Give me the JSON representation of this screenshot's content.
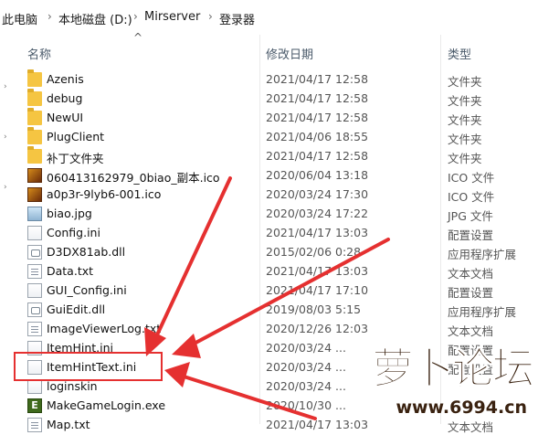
{
  "breadcrumb": [
    "此电脑",
    "本地磁盘 (D:)",
    "Mirserver",
    "登录器"
  ],
  "breadcrumb_sep": "›",
  "columns": {
    "name": "名称",
    "date": "修改日期",
    "type": "类型"
  },
  "files": [
    {
      "name": "Azenis",
      "date": "2021/04/17 12:58",
      "type": "文件夹",
      "icon": "folder-icon"
    },
    {
      "name": "debug",
      "date": "2021/04/17 12:58",
      "type": "文件夹",
      "icon": "folder-icon"
    },
    {
      "name": "NewUI",
      "date": "2021/04/17 12:58",
      "type": "文件夹",
      "icon": "folder-icon"
    },
    {
      "name": "PlugClient",
      "date": "2021/04/06 18:55",
      "type": "文件夹",
      "icon": "folder-icon"
    },
    {
      "name": "补丁文件夹",
      "date": "2021/04/17 12:58",
      "type": "文件夹",
      "icon": "folder-icon"
    },
    {
      "name": "060413162979_0biao_副本.ico",
      "date": "2020/06/04 13:18",
      "type": "ICO 文件",
      "icon": "ico-file-icon"
    },
    {
      "name": "a0p3r-9lyb6-001.ico",
      "date": "2020/03/24 17:30",
      "type": "ICO 文件",
      "icon": "ico-file-icon"
    },
    {
      "name": "biao.jpg",
      "date": "2020/03/24 17:22",
      "type": "JPG 文件",
      "icon": "jpg-file-icon"
    },
    {
      "name": "Config.ini",
      "date": "2021/04/17 13:03",
      "type": "配置设置",
      "icon": "config-file-icon"
    },
    {
      "name": "D3DX81ab.dll",
      "date": "2015/02/06 0:28",
      "type": "应用程序扩展",
      "icon": "dll-file-icon"
    },
    {
      "name": "Data.txt",
      "date": "2021/04/17 13:03",
      "type": "文本文档",
      "icon": "text-file-icon"
    },
    {
      "name": "GUI_Config.ini",
      "date": "2021/04/17 17:10",
      "type": "配置设置",
      "icon": "config-file-icon"
    },
    {
      "name": "GuiEdit.dll",
      "date": "2019/08/03 5:15",
      "type": "应用程序扩展",
      "icon": "dll-file-icon"
    },
    {
      "name": "ImageViewerLog.txt",
      "date": "2020/12/26 12:03",
      "type": "文本文档",
      "icon": "text-file-icon"
    },
    {
      "name": "ItemHint.ini",
      "date": "2020/03/24 ...",
      "type": "配置设置",
      "icon": "config-file-icon"
    },
    {
      "name": "ItemHintText.ini",
      "date": "2020/03/24 ...",
      "type": "配置设置",
      "icon": "config-file-icon"
    },
    {
      "name": "loginskin",
      "date": "2020/03/24 ...",
      "type": "",
      "icon": "config-file-icon"
    },
    {
      "name": "MakeGameLogin.exe",
      "date": "2020/10/30 ...",
      "type": "",
      "icon": "exe-file-icon"
    },
    {
      "name": "Map.txt",
      "date": "2021/04/17 13:03",
      "type": "文本文档",
      "icon": "text-file-icon"
    }
  ],
  "watermark": {
    "logo": "萝卜论坛",
    "site": "www.6994.cn"
  },
  "colors": {
    "highlight": "#e53030",
    "folder": "#f5c542"
  }
}
